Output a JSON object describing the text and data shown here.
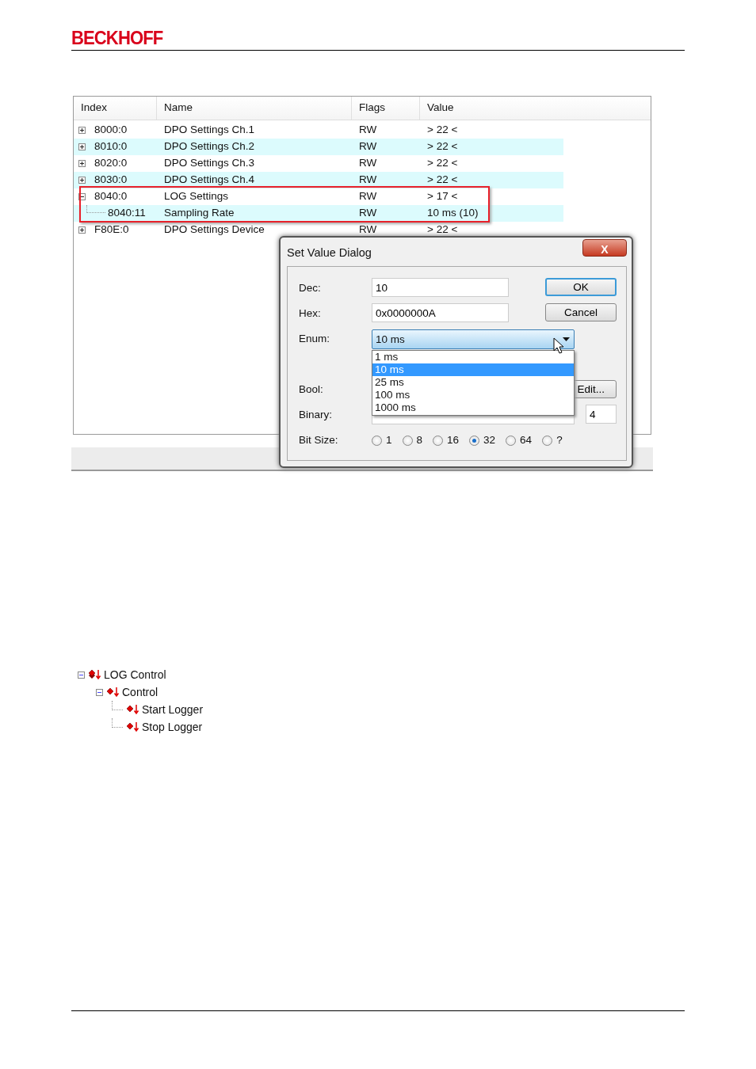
{
  "header": {
    "logo": "BECKHOFF"
  },
  "table": {
    "columns": [
      "Index",
      "Name",
      "Flags",
      "Value"
    ],
    "rows": [
      {
        "index": "8000:0",
        "name": "DPO Settings Ch.1",
        "flags": "RW",
        "value": "> 22 <",
        "expanded": false,
        "marked": false
      },
      {
        "index": "8010:0",
        "name": "DPO Settings Ch.2",
        "flags": "RW",
        "value": "> 22 <",
        "expanded": false,
        "marked": false
      },
      {
        "index": "8020:0",
        "name": "DPO Settings Ch.3",
        "flags": "RW",
        "value": "> 22 <",
        "expanded": false,
        "marked": false
      },
      {
        "index": "8030:0",
        "name": "DPO Settings Ch.4",
        "flags": "RW",
        "value": "> 22 <",
        "expanded": false,
        "marked": false
      },
      {
        "index": "8040:0",
        "name": "LOG Settings",
        "flags": "RW",
        "value": "> 17 <",
        "expanded": true,
        "marked": true,
        "children": [
          {
            "index": "8040:11",
            "name": "Sampling Rate",
            "flags": "RW",
            "value": "10 ms (10)"
          }
        ]
      },
      {
        "index": "F80E:0",
        "name": "DPO Settings Device",
        "flags": "RW",
        "value": "> 22 <",
        "expanded": false,
        "marked": false
      }
    ]
  },
  "dialog": {
    "title": "Set Value Dialog",
    "close": "X",
    "dec_label": "Dec:",
    "dec": "10",
    "hex_label": "Hex:",
    "hex": "0x0000000A",
    "enum_label": "Enum:",
    "enum": "10 ms",
    "enum_options": [
      {
        "label": "1 ms",
        "selected": false
      },
      {
        "label": "10 ms",
        "selected": true
      },
      {
        "label": "25 ms",
        "selected": false
      },
      {
        "label": "100 ms",
        "selected": false
      },
      {
        "label": "1000 ms",
        "selected": false
      }
    ],
    "bool_label": "Bool:",
    "edit_button": "Edit...",
    "binary_label": "Binary:",
    "size": "4",
    "bit_size_label": "Bit Size:",
    "bit_sizes": [
      {
        "label": "1",
        "selected": false
      },
      {
        "label": "8",
        "selected": false
      },
      {
        "label": "16",
        "selected": false
      },
      {
        "label": "32",
        "selected": true
      },
      {
        "label": "64",
        "selected": false
      },
      {
        "label": "?",
        "selected": false
      }
    ],
    "buttons": [
      "OK",
      "Cancel"
    ]
  },
  "tree": [
    {
      "label": "LOG Control",
      "kind": "group",
      "expanded": true,
      "children": [
        {
          "label": "Control",
          "kind": "item",
          "expanded": true,
          "children": [
            {
              "label": "Start Logger",
              "kind": "item"
            },
            {
              "label": "Stop Logger",
              "kind": "item"
            }
          ]
        }
      ]
    }
  ]
}
